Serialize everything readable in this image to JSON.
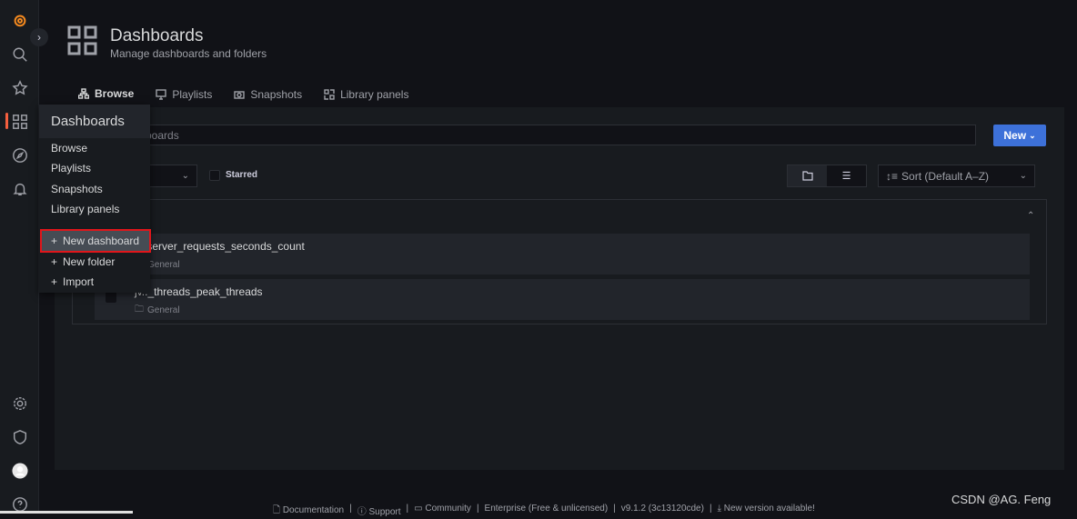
{
  "header": {
    "title": "Dashboards",
    "subtitle": "Manage dashboards and folders"
  },
  "tabs": [
    {
      "label": "Browse",
      "icon": "sitemap-icon",
      "active": true
    },
    {
      "label": "Playlists",
      "icon": "presentation-icon"
    },
    {
      "label": "Snapshots",
      "icon": "camera-icon"
    },
    {
      "label": "Library panels",
      "icon": "library-panels-icon"
    }
  ],
  "search": {
    "placeholder": "Search dashboards",
    "visible_text": "boards"
  },
  "new_button": "New",
  "starred_label": "Starred",
  "sort": {
    "value": "Sort (Default A–Z)"
  },
  "dashboards": [
    {
      "title": "http_server_requests_seconds_count",
      "visible_title": "p_server_requests_seconds_count",
      "folder": "General"
    },
    {
      "title": "jvm_threads_peak_threads",
      "visible_title": "jv.._threads_peak_threads",
      "folder": "General"
    }
  ],
  "menu": {
    "title": "Dashboards",
    "items": [
      "Browse",
      "Playlists",
      "Snapshots",
      "Library panels"
    ],
    "actions": [
      "New dashboard",
      "New folder",
      "Import"
    ]
  },
  "footer": [
    "Documentation",
    "Support",
    "Community",
    "Enterprise (Free & unlicensed)",
    "v9.1.2 (3c13120cde)",
    "New version available!"
  ],
  "watermark": "CSDN @AG.  Feng",
  "colors": {
    "accent": "#f55f3e",
    "primary": "#3d71d9",
    "highlight": "#e0161b"
  }
}
